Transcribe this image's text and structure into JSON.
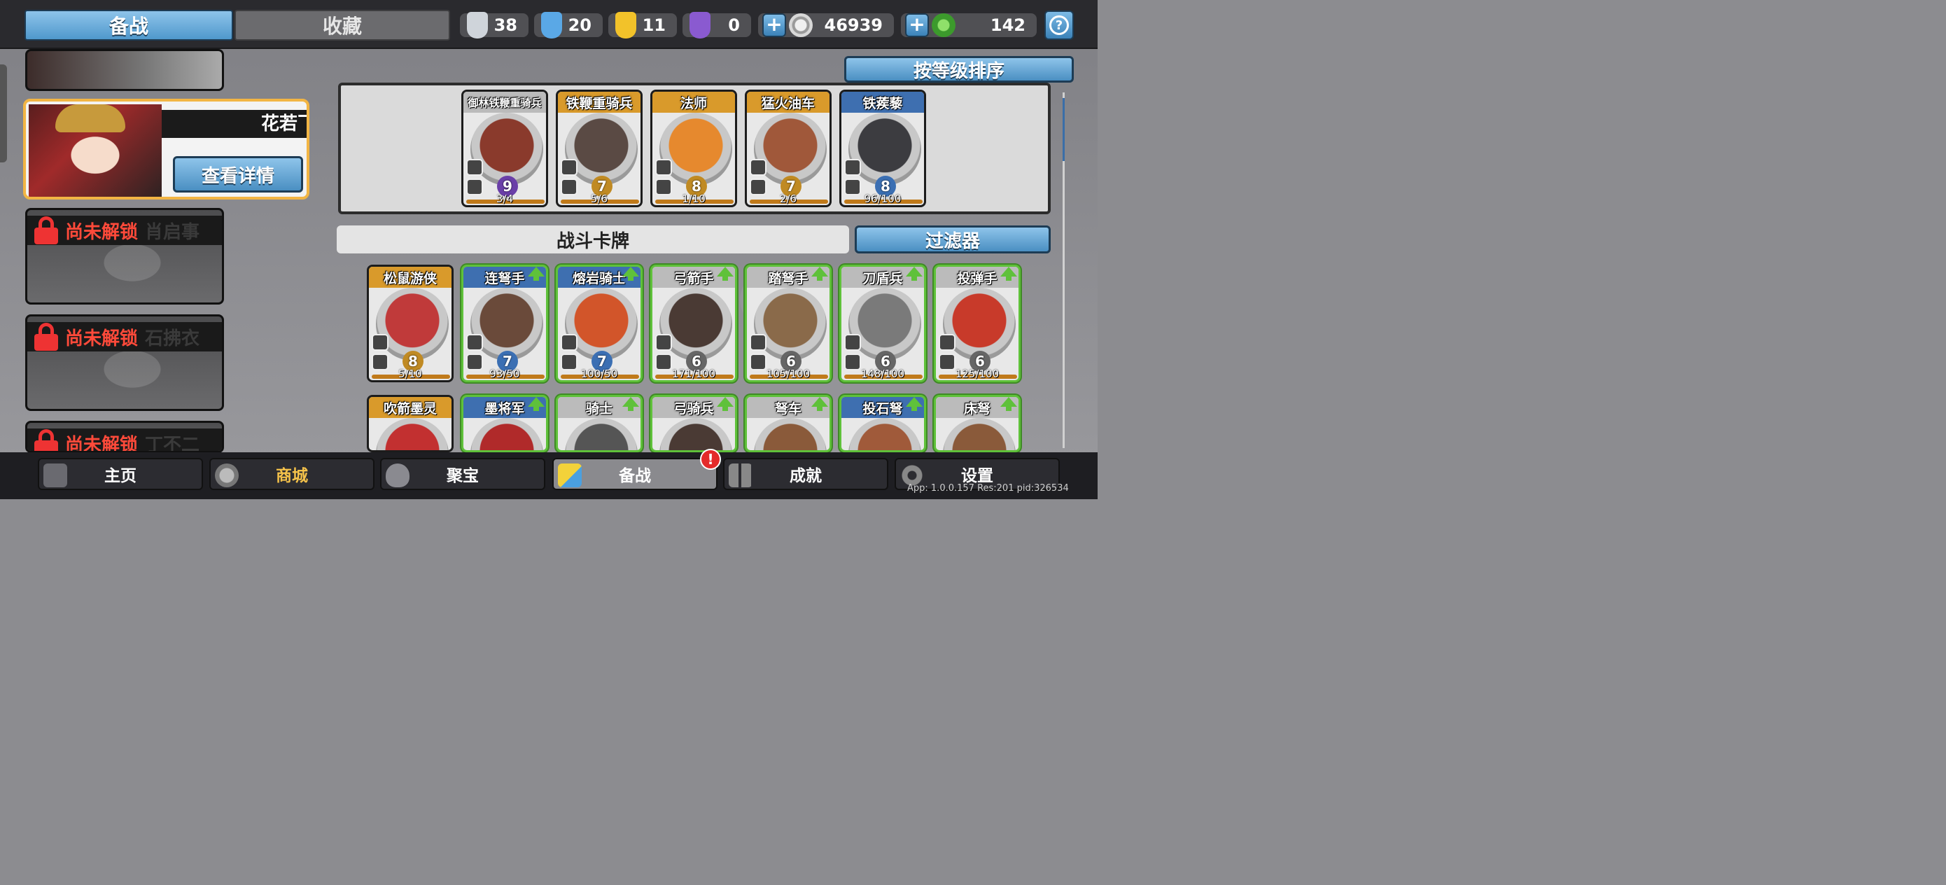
{
  "tabs": {
    "active": "备战",
    "inactive": "收藏"
  },
  "resources": [
    {
      "icon": "silver-shield-icon",
      "value": "38",
      "color": "#cfd4da"
    },
    {
      "icon": "blue-crystal-icon",
      "value": "20",
      "color": "#5aa8e6"
    },
    {
      "icon": "gold-shield-icon",
      "value": "11",
      "color": "#f2c22a"
    },
    {
      "icon": "purple-shield-icon",
      "value": "0",
      "color": "#8a5ad0"
    }
  ],
  "currency": {
    "silver_coin": "46939",
    "green_gem": "142",
    "plus_symbol": "+"
  },
  "help_symbol": "?",
  "selected_hero": {
    "name": "花若飞",
    "detail_button": "查看详情"
  },
  "locked_heroes": [
    {
      "status": "尚未解锁",
      "name": "肖启事"
    },
    {
      "status": "尚未解锁",
      "name": "石拂衣"
    },
    {
      "status": "尚未解锁",
      "name": "丁不二"
    }
  ],
  "sort_button": "按等级排序",
  "section_title": "战斗卡牌",
  "filter_button": "过滤器",
  "deck_cards": [
    {
      "name": "御林铁鞭重骑兵",
      "level": "9",
      "count": "3/4",
      "rarity": "purple",
      "head": "gray",
      "art": "#8a3a2c"
    },
    {
      "name": "铁鞭重骑兵",
      "level": "7",
      "count": "5/6",
      "rarity": "gold",
      "head": "gold",
      "art": "#5a4a44"
    },
    {
      "name": "法师",
      "level": "8",
      "count": "1/10",
      "rarity": "gold",
      "head": "gold",
      "art": "#e6892e"
    },
    {
      "name": "猛火油车",
      "level": "7",
      "count": "2/6",
      "rarity": "gold",
      "head": "gold",
      "art": "#a0583a"
    },
    {
      "name": "铁蒺藜",
      "level": "8",
      "count": "96/100",
      "rarity": "blue",
      "head": "blue",
      "art": "#3c3c40"
    }
  ],
  "battle_cards_row1": [
    {
      "name": "松鼠游侠",
      "level": "8",
      "count": "5/10",
      "rarity": "gold",
      "head": "gold",
      "upgrade": false,
      "art": "#c03a3a"
    },
    {
      "name": "连弩手",
      "level": "7",
      "count": "93/50",
      "rarity": "blue",
      "head": "blue",
      "upgrade": true,
      "art": "#6a4a3a"
    },
    {
      "name": "熔岩骑士",
      "level": "7",
      "count": "100/50",
      "rarity": "blue",
      "head": "blue",
      "upgrade": true,
      "art": "#d2552a"
    },
    {
      "name": "弓箭手",
      "level": "6",
      "count": "171/100",
      "rarity": "gray",
      "head": "gray",
      "upgrade": true,
      "art": "#4a3a34"
    },
    {
      "name": "踏弩手",
      "level": "6",
      "count": "105/100",
      "rarity": "gray",
      "head": "gray",
      "upgrade": true,
      "art": "#8a6a4a"
    },
    {
      "name": "刀盾兵",
      "level": "6",
      "count": "148/100",
      "rarity": "gray",
      "head": "gray",
      "upgrade": true,
      "art": "#7a7a7a"
    },
    {
      "name": "投弹手",
      "level": "6",
      "count": "125/100",
      "rarity": "gray",
      "head": "gray",
      "upgrade": true,
      "art": "#c83a2a"
    }
  ],
  "battle_cards_row2": [
    {
      "name": "吹箭墨灵",
      "head": "gold",
      "upgrade": false,
      "art": "#c23030"
    },
    {
      "name": "墨将军",
      "head": "blue",
      "upgrade": true,
      "art": "#b02a2a"
    },
    {
      "name": "骑士",
      "head": "gray",
      "upgrade": true,
      "art": "#555"
    },
    {
      "name": "弓骑兵",
      "head": "gray",
      "upgrade": true,
      "art": "#4a3a34"
    },
    {
      "name": "弩车",
      "head": "gray",
      "upgrade": true,
      "art": "#8a5a3a"
    },
    {
      "name": "投石弩",
      "head": "blue",
      "upgrade": true,
      "art": "#a05a3a"
    },
    {
      "name": "床弩",
      "head": "gray",
      "upgrade": true,
      "art": "#8a5a3a"
    }
  ],
  "nav": [
    {
      "label": "主页",
      "icon": "castle-icon"
    },
    {
      "label": "商城",
      "icon": "coins-icon"
    },
    {
      "label": "聚宝",
      "icon": "treasure-bowl-icon"
    },
    {
      "label": "备战",
      "icon": "cards-icon"
    },
    {
      "label": "成就",
      "icon": "achievements-icon"
    },
    {
      "label": "设置",
      "icon": "gear-icon"
    }
  ],
  "alert_badge": "!",
  "version": "App: 1.0.0.157 Res:201 pid:326534"
}
